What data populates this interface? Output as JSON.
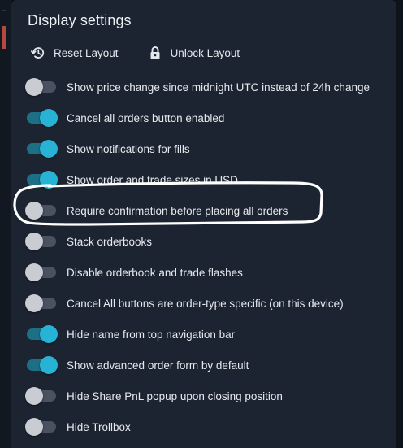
{
  "dialog": {
    "title": "Display settings"
  },
  "actions": {
    "reset_label": "Reset Layout",
    "unlock_label": "Unlock Layout"
  },
  "settings": [
    {
      "label": "Show price change since midnight UTC instead of 24h change",
      "enabled": false
    },
    {
      "label": "Cancel all orders button enabled",
      "enabled": true
    },
    {
      "label": "Show notifications for fills",
      "enabled": true
    },
    {
      "label": "Show order and trade sizes in USD",
      "enabled": true
    },
    {
      "label": "Require confirmation before placing all orders",
      "enabled": false
    },
    {
      "label": "Stack orderbooks",
      "enabled": false
    },
    {
      "label": "Disable orderbook and trade flashes",
      "enabled": false
    },
    {
      "label": "Cancel All buttons are order-type specific (on this device)",
      "enabled": false
    },
    {
      "label": "Hide name from top navigation bar",
      "enabled": true
    },
    {
      "label": "Show advanced order form by default",
      "enabled": true
    },
    {
      "label": "Hide Share PnL popup upon closing position",
      "enabled": false
    },
    {
      "label": "Hide Trollbox",
      "enabled": false
    }
  ],
  "colors": {
    "panel_bg": "#1d2431",
    "toggle_on": "#27b3d6",
    "toggle_off": "#c9ccd2",
    "text": "#e6e9ee"
  }
}
